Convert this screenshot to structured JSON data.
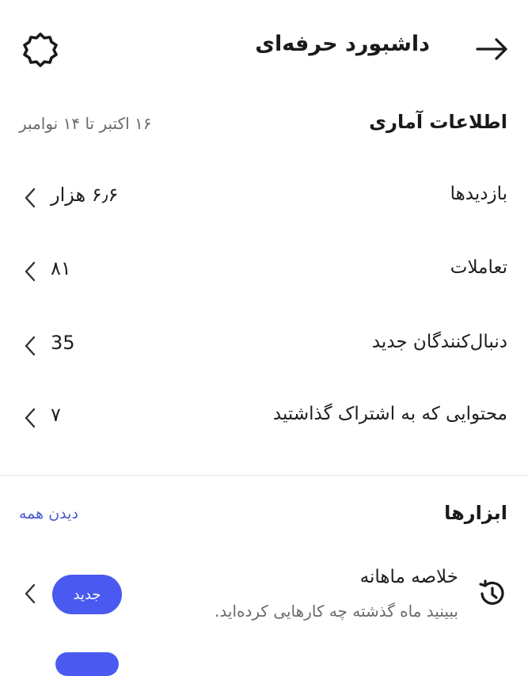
{
  "header": {
    "title": "داشبورد حرفه‌ای",
    "back_icon": "arrow-right-icon",
    "settings_icon": "gear-icon"
  },
  "stats": {
    "title": "اطلاعات آماری",
    "range": "۱۶ اکتبر تا ۱۴ نوامبر",
    "items": [
      {
        "label": "بازدیدها",
        "value": "۶٫۶ هزار"
      },
      {
        "label": "تعاملات",
        "value": "۸۱"
      },
      {
        "label": "دنبال‌کنندگان جدید",
        "value": "35"
      },
      {
        "label": "محتوایی که به اشتراک گذاشتید",
        "value": "۷"
      }
    ]
  },
  "tools": {
    "title": "ابزارها",
    "see_all": "دیدن همه",
    "items": [
      {
        "title": "خلاصه ماهانه",
        "description": "ببینید ماه گذشته چه کارهایی کرده‌اید.",
        "badge": "جدید",
        "icon": "history-icon"
      }
    ]
  },
  "colors": {
    "accent": "#4a5af0",
    "link": "#4a5bd4"
  }
}
